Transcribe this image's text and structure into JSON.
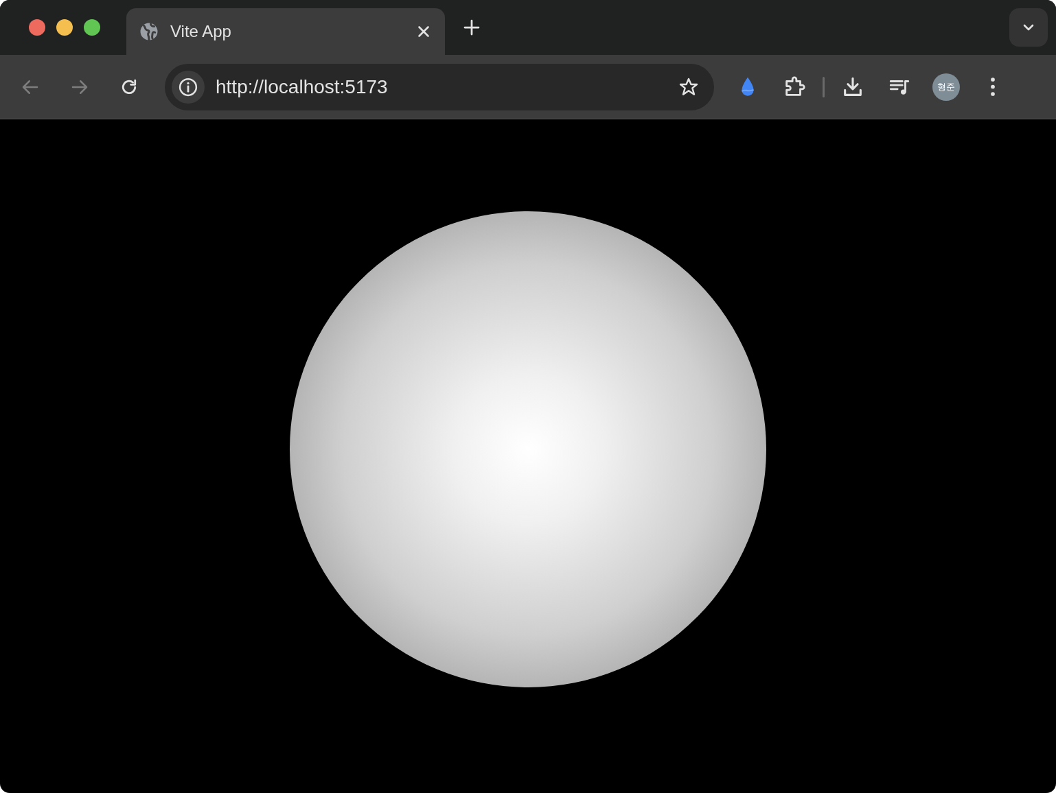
{
  "tabs": [
    {
      "title": "Vite App",
      "selected": true
    }
  ],
  "toolbar": {
    "back": {
      "disabled": true
    },
    "forward": {
      "disabled": true
    },
    "url": "http://localhost:5173",
    "profile": "형준"
  }
}
